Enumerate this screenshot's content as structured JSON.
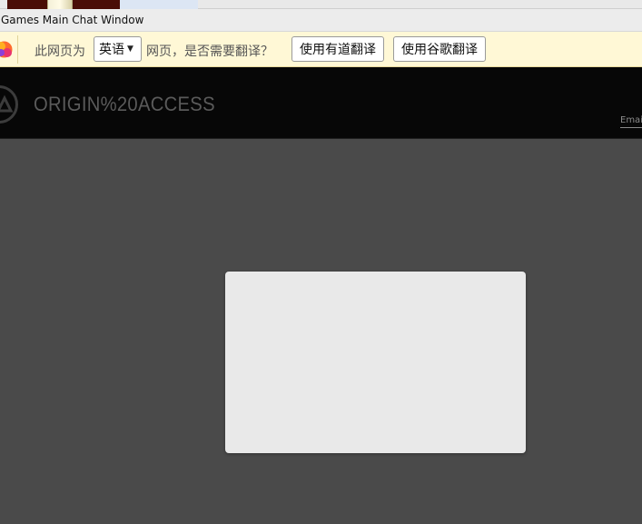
{
  "window": {
    "title": "Games Main Chat Window"
  },
  "translate_bar": {
    "prefix_text": "此网页为",
    "language_value": "英语",
    "prompt_text": "网页，是否需要翻译？",
    "youdao_button": "使用有道翻译",
    "google_button": "使用谷歌翻译"
  },
  "header": {
    "brand_title": "ORIGIN%20ACCESS",
    "email_tab": "Emai",
    "logo_icon": "ea-logo-icon"
  },
  "colors": {
    "header_bg": "#070707",
    "content_bg": "#4a4a4a",
    "card_bg": "#e9e9e9",
    "translate_bar_bg": "#fff8d6"
  }
}
